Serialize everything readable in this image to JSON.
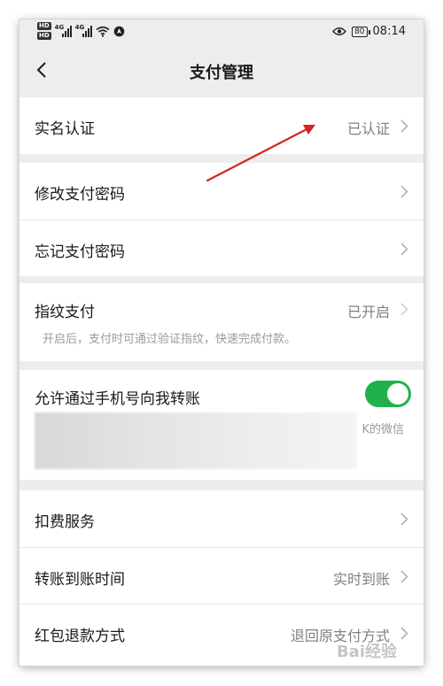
{
  "status_bar": {
    "hd_badge_top": "HD",
    "hd_badge_bottom": "HD",
    "signal_1_label": "4G",
    "signal_2_label": "4G",
    "battery": "80",
    "time": "08:14"
  },
  "nav": {
    "title": "支付管理",
    "back_icon": "chevron-left-icon"
  },
  "sections": {
    "real_name": {
      "label": "实名认证",
      "value": "已认证"
    },
    "change_password": {
      "label": "修改支付密码"
    },
    "forgot_password": {
      "label": "忘记支付密码"
    },
    "fingerprint": {
      "label": "指纹支付",
      "value": "已开启",
      "hint": "开启后，支付时可通过验证指纹，快速完成付款。"
    },
    "phone_transfer": {
      "label": "允许通过手机号向我转账",
      "toggle_on": true,
      "partial_text": "K的微信"
    },
    "deduction": {
      "label": "扣费服务"
    },
    "transfer_time": {
      "label": "转账到账时间",
      "value": "实时到账"
    },
    "red_packet_refund": {
      "label": "红包退款方式",
      "value": "退回原支付方式"
    }
  },
  "watermark": "Bai经验",
  "colors": {
    "page_bg": "#ededed",
    "toggle_green": "#20b14a",
    "annotation_red": "#d9231f"
  }
}
